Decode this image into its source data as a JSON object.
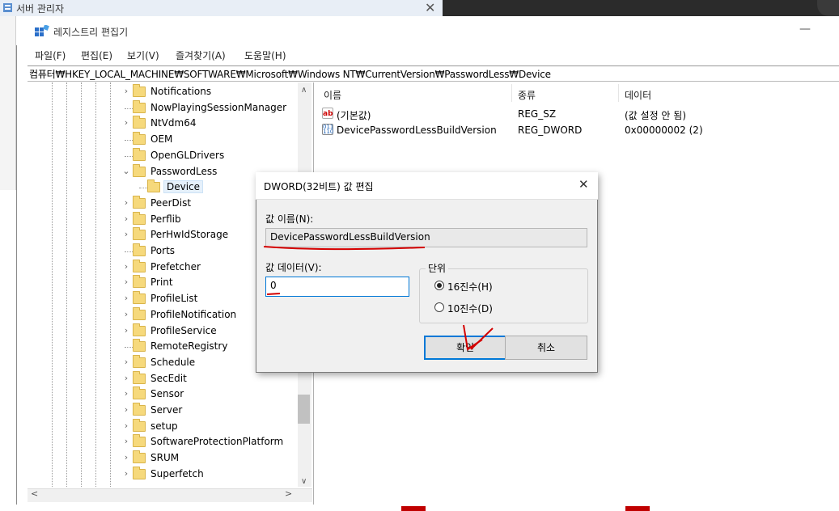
{
  "server_manager": {
    "title": "서버 관리자",
    "close_glyph": "✕"
  },
  "regedit": {
    "title": "레지스트리 편집기",
    "minimize_glyph": "—",
    "menu": [
      "파일(F)",
      "편집(E)",
      "보기(V)",
      "즐겨찾기(A)",
      "도움말(H)"
    ],
    "address": "컴퓨터₩HKEY_LOCAL_MACHINE₩SOFTWARE₩Microsoft₩Windows NT₩CurrentVersion₩PasswordLess₩Device"
  },
  "tree": {
    "items": [
      {
        "label": "Notifications",
        "chevron": "›"
      },
      {
        "label": "NowPlayingSessionManager",
        "chevron": ""
      },
      {
        "label": "NtVdm64",
        "chevron": "›"
      },
      {
        "label": "OEM",
        "chevron": ""
      },
      {
        "label": "OpenGLDrivers",
        "chevron": ""
      },
      {
        "label": "PasswordLess",
        "chevron": "⌄"
      },
      {
        "label": "Device",
        "chevron": ""
      },
      {
        "label": "PeerDist",
        "chevron": "›"
      },
      {
        "label": "Perflib",
        "chevron": "›"
      },
      {
        "label": "PerHwIdStorage",
        "chevron": "›"
      },
      {
        "label": "Ports",
        "chevron": ""
      },
      {
        "label": "Prefetcher",
        "chevron": "›"
      },
      {
        "label": "Print",
        "chevron": "›"
      },
      {
        "label": "ProfileList",
        "chevron": "›"
      },
      {
        "label": "ProfileNotification",
        "chevron": "›"
      },
      {
        "label": "ProfileService",
        "chevron": "›"
      },
      {
        "label": "RemoteRegistry",
        "chevron": ""
      },
      {
        "label": "Schedule",
        "chevron": "›"
      },
      {
        "label": "SecEdit",
        "chevron": "›"
      },
      {
        "label": "Sensor",
        "chevron": "›"
      },
      {
        "label": "Server",
        "chevron": "›"
      },
      {
        "label": "setup",
        "chevron": "›"
      },
      {
        "label": "SoftwareProtectionPlatform",
        "chevron": "›"
      },
      {
        "label": "SRUM",
        "chevron": "›"
      },
      {
        "label": "Superfetch",
        "chevron": "›"
      }
    ],
    "scroll_up": "∧",
    "scroll_down": "∨",
    "scroll_left": "<",
    "scroll_right": ">"
  },
  "values": {
    "columns": {
      "name": "이름",
      "type": "종류",
      "data": "데이터"
    },
    "rows": [
      {
        "icon": "ab",
        "name": "(기본값)",
        "type": "REG_SZ",
        "data": "(값 설정 안 됨)"
      },
      {
        "icon": "bin",
        "name": "DevicePasswordLessBuildVersion",
        "type": "REG_DWORD",
        "data": "0x00000002 (2)"
      }
    ]
  },
  "dialog": {
    "title": "DWORD(32비트) 값 편집",
    "close_glyph": "✕",
    "name_label": "값 이름(N):",
    "name_value": "DevicePasswordLessBuildVersion",
    "data_label": "값 데이터(V):",
    "data_value": "0",
    "base_group": "단위",
    "hex_label": "16진수(H)",
    "dec_label": "10진수(D)",
    "ok_label": "확인",
    "cancel_label": "취소",
    "selected_base": "hex"
  },
  "colors": {
    "annotation_red": "#d40000",
    "selection_blue": "#0078d7"
  }
}
